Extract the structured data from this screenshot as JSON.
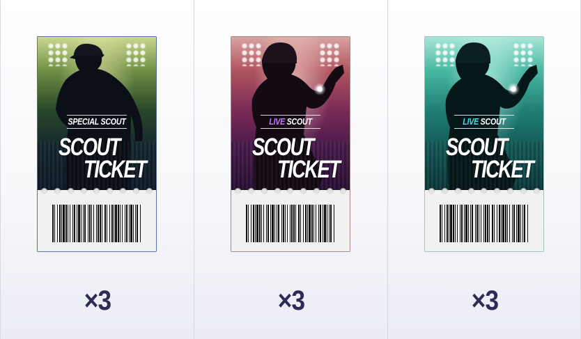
{
  "rewards": [
    {
      "scout_prefix": "SPECIAL",
      "scout_suffix": " SCOUT",
      "title_line_1": "SCOUT",
      "title_line_2": "TICKET",
      "quantity": "×3",
      "theme": "special",
      "accent_color": "#ffffff",
      "silhouette": "batter-with-cap"
    },
    {
      "scout_prefix": "LIVE",
      "scout_suffix": " SCOUT",
      "title_line_1": "SCOUT",
      "title_line_2": "TICKET",
      "quantity": "×3",
      "theme": "live-red",
      "accent_color": "#c178ff",
      "silhouette": "pitcher-with-helmet"
    },
    {
      "scout_prefix": "LIVE",
      "scout_suffix": " SCOUT",
      "title_line_1": "SCOUT",
      "title_line_2": "TICKET",
      "quantity": "×3",
      "theme": "live-teal",
      "accent_color": "#39e0e6",
      "silhouette": "pitcher-with-helmet"
    }
  ]
}
